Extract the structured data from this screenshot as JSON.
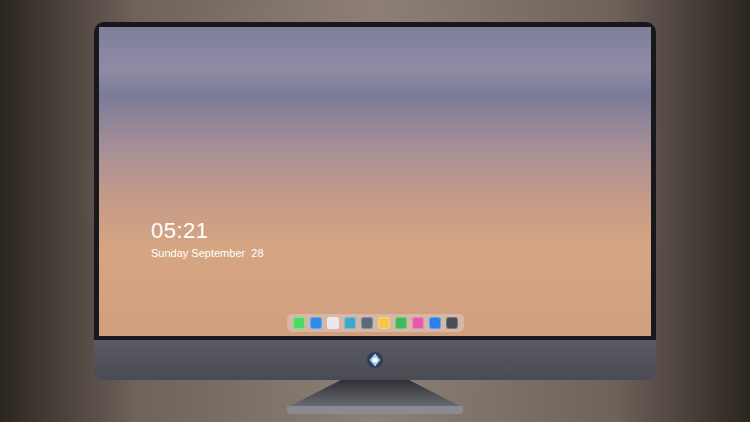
{
  "lock_screen": {
    "time": "05:21",
    "date": "Sunday September  28"
  },
  "dock": {
    "items": [
      {
        "color": "#4cd964"
      },
      {
        "color": "#2f8be6"
      },
      {
        "color": "#e8e8ee"
      },
      {
        "color": "#3fa7c9"
      },
      {
        "color": "#5b6b7c"
      },
      {
        "color": "#f5c84a"
      },
      {
        "color": "#3dbb5a"
      },
      {
        "color": "#e85aa8"
      },
      {
        "color": "#2a7ff0"
      },
      {
        "color": "#4a4d55"
      }
    ]
  }
}
